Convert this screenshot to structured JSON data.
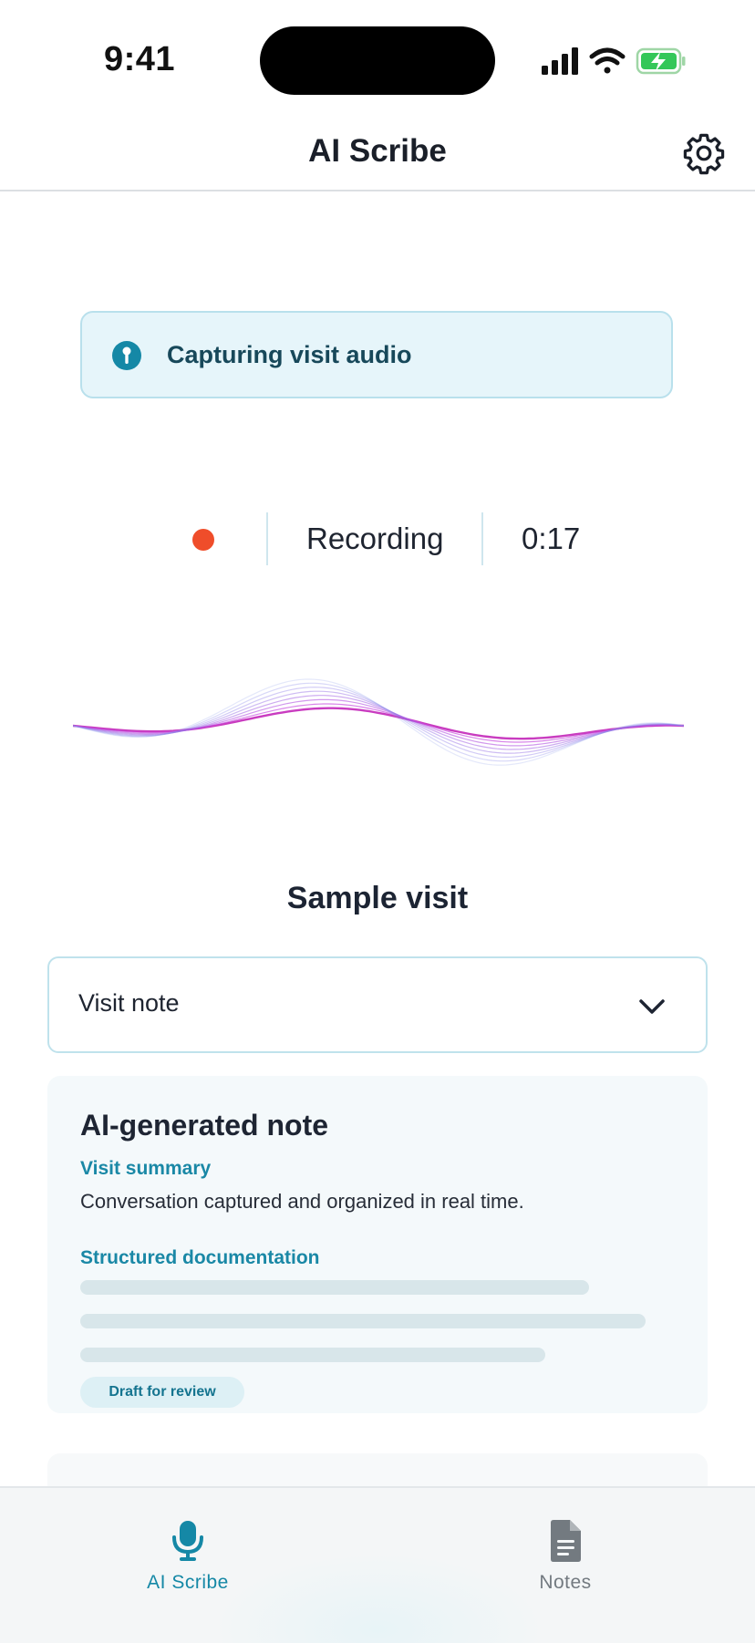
{
  "status_bar": {
    "time": "9:41"
  },
  "header": {
    "title": "AI Scribe"
  },
  "banner": {
    "text": "Capturing visit audio"
  },
  "recording": {
    "label": "Recording",
    "timer": "0:17"
  },
  "visit": {
    "title": "Sample visit",
    "note_type": {
      "selected": "Visit note"
    }
  },
  "note_card": {
    "heading": "AI-generated note",
    "summary_label": "Visit summary",
    "summary_text": "Conversation captured and organized in real time.",
    "structured_label": "Structured documentation",
    "badge": "Draft for review"
  },
  "tab_bar": {
    "tabs": [
      {
        "label": "AI Scribe",
        "icon": "microphone-icon",
        "active": true
      },
      {
        "label": "Notes",
        "icon": "document-icon",
        "active": false
      }
    ]
  },
  "colors": {
    "accent": "#1588a6",
    "recording_dot": "#ef4d2a",
    "banner_bg": "#e6f5fa",
    "waveform": "#c93cc0"
  }
}
